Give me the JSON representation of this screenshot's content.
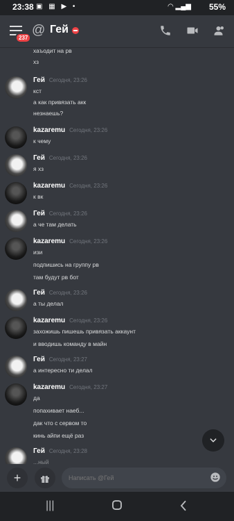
{
  "status_bar": {
    "time": "23:38",
    "battery": "55%"
  },
  "header": {
    "badge": "237",
    "at_symbol": "@",
    "title": "Гей"
  },
  "messages": [
    {
      "author": "",
      "timestamp": "",
      "lines": [
        "хаъодит на рв",
        "хз"
      ]
    },
    {
      "author": "Гей",
      "timestamp": "Сегодня, 23:26",
      "lines": [
        "кст",
        "а как привязать акк",
        "незнаешь?"
      ]
    },
    {
      "author": "kazaremu",
      "timestamp": "Сегодня, 23:26",
      "lines": [
        "к чему"
      ]
    },
    {
      "author": "Гей",
      "timestamp": "Сегодня, 23:26",
      "lines": [
        "я хз"
      ]
    },
    {
      "author": "kazaremu",
      "timestamp": "Сегодня, 23:26",
      "lines": [
        "к вк"
      ]
    },
    {
      "author": "Гей",
      "timestamp": "Сегодня, 23:26",
      "lines": [
        "а че там делать"
      ]
    },
    {
      "author": "kazaremu",
      "timestamp": "Сегодня, 23:26",
      "lines": [
        "изи",
        "подпишись на группу рв",
        "там будут рв бот"
      ]
    },
    {
      "author": "Гей",
      "timestamp": "Сегодня, 23:26",
      "lines": [
        "а ты делал"
      ]
    },
    {
      "author": "kazaremu",
      "timestamp": "Сегодня, 23:26",
      "lines": [
        "захожишь пишешь привязать аккаунт",
        "и вводишь команду в майн"
      ]
    },
    {
      "author": "Гей",
      "timestamp": "Сегодня, 23:27",
      "lines": [
        "а интересно ти делал"
      ]
    },
    {
      "author": "kazaremu",
      "timestamp": "Сегодня, 23:27",
      "lines": [
        "да",
        "попахивает наеб...",
        "дак что с сервом то",
        "кинь айпи ещё раз"
      ]
    },
    {
      "author": "Гей",
      "timestamp": "Сегодня, 23:28",
      "lines": [
        "...ный"
      ]
    }
  ],
  "composer": {
    "placeholder": "Написать @Гей"
  },
  "icons": {
    "call": "phone-icon",
    "video": "video-camera-icon",
    "members": "members-icon",
    "add": "plus-icon",
    "gift": "gift-icon",
    "emoji": "emoji-icon",
    "scroll": "chevron-down-icon"
  },
  "colors": {
    "background": "#36393f",
    "dark": "#202225",
    "badge": "#ed4245",
    "dnd": "#ed4245"
  }
}
